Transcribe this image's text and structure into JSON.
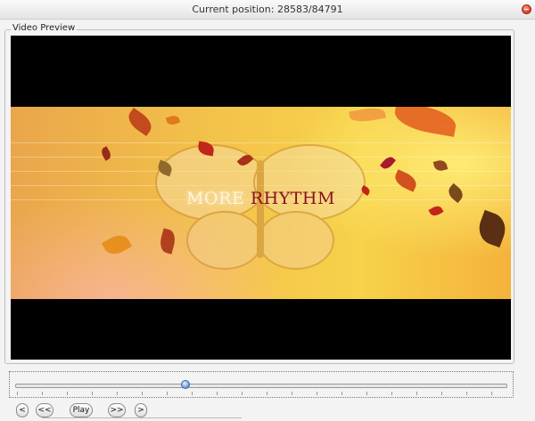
{
  "window": {
    "title": "Current position: 28583/84791"
  },
  "group": {
    "label": "Video Preview"
  },
  "video": {
    "text_part1": "MORE",
    "text_part2": "RHYTHM"
  },
  "controls": {
    "start": "<",
    "rewind": "<<",
    "play": "Play",
    "forward": ">>",
    "end": ">"
  },
  "position": {
    "current": 28583,
    "total": 84791,
    "fraction": 0.337
  },
  "colors": {
    "accent": "#5b8fd6",
    "title_red": "#8a0f22"
  }
}
